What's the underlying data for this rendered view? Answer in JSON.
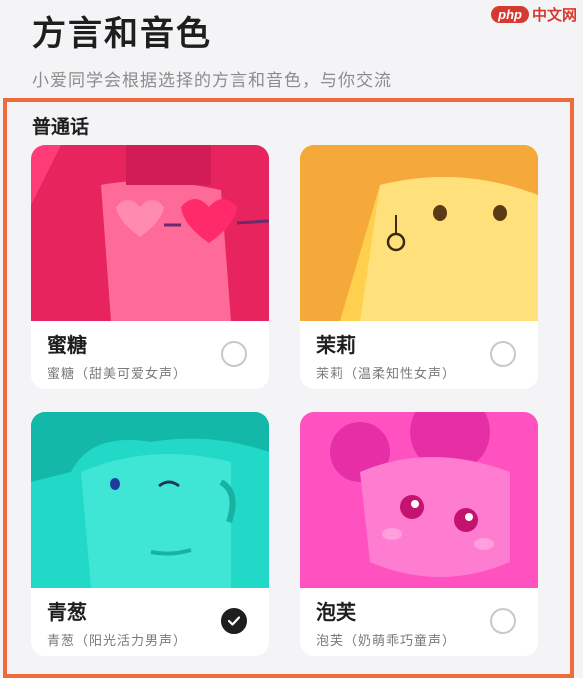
{
  "header": {
    "title": "方言和音色",
    "subtitle": "小爱同学会根据选择的方言和音色，与你交流"
  },
  "watermark": {
    "logo": "php",
    "text": "中文网"
  },
  "section": {
    "title": "普通话"
  },
  "voices": [
    {
      "name": "蜜糖",
      "desc": "蜜糖（甜美可爱女声）",
      "selected": false,
      "color": "#ff3b78"
    },
    {
      "name": "茉莉",
      "desc": "茉莉（温柔知性女声）",
      "selected": false,
      "color": "#ffc93c"
    },
    {
      "name": "青葱",
      "desc": "青葱（阳光活力男声）",
      "selected": true,
      "color": "#22d9c8"
    },
    {
      "name": "泡芙",
      "desc": "泡芙（奶萌乖巧童声）",
      "selected": false,
      "color": "#ff52c0"
    }
  ],
  "colors": {
    "accent_border": "#ef6b3c",
    "selected": "#1e1e1e"
  }
}
